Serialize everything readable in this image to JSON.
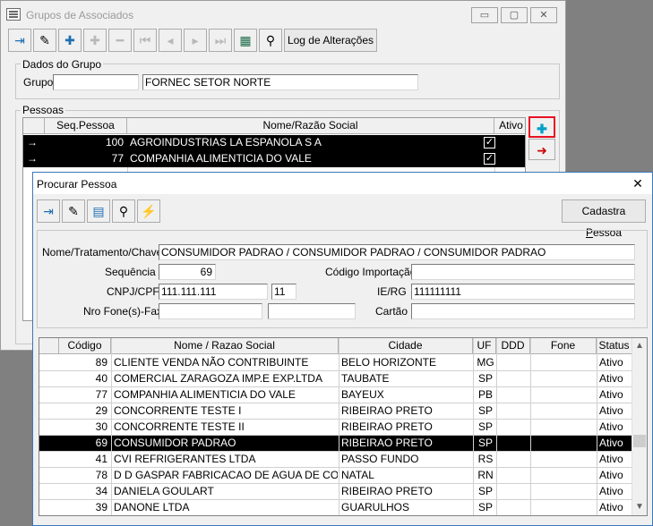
{
  "win1": {
    "title": "Grupos de Associados",
    "caption_minimize": "▭",
    "caption_maximize": "▢",
    "caption_close": "✕",
    "toolbar_log_label": "Log de Alterações",
    "dados_legend": "Dados do Grupo",
    "grupo_label": "Grupo",
    "grupo_code": "",
    "grupo_name": "FORNEC SETOR NORTE",
    "pessoas_legend": "Pessoas",
    "grid_headers": [
      "Seq.Pessoa",
      "Nome/Razão Social",
      "Ativo"
    ],
    "rows": [
      {
        "marker": "→",
        "seq": "100",
        "nome": "AGROINDUSTRIAS LA ESPANOLA S A",
        "ativo": "✓"
      },
      {
        "marker": "→",
        "seq": "77",
        "nome": "COMPANHIA ALIMENTICIA DO VALE",
        "ativo": "✓"
      }
    ],
    "side_add_icon": "add-person-icon",
    "side_remove_icon": "remove-person-icon"
  },
  "win2": {
    "title": "Procurar Pessoa",
    "close_glyph": "✕",
    "cadastra_prefix": "Cadastra ",
    "cadastra_mnemonic": "P",
    "cadastra_suffix": "essoa",
    "nome_label": "Nome/Tratamento/Chave",
    "nome_value": "CONSUMIDOR PADRAO / CONSUMIDOR PADRAO / CONSUMIDOR PADRAO",
    "sequencia_label": "Sequência",
    "sequencia_value": "69",
    "codigo_importacao_label": "Código Importação",
    "codigo_importacao_value": "",
    "cnpj_label": "CNPJ/CPF",
    "cnpj_value": "111.111.111",
    "cnpj_digit": "11",
    "ierg_label": "IE/RG",
    "ierg_value": "111111111",
    "fone_label": "Nro Fone(s)-Fax",
    "fone1_value": "",
    "fone2_value": "",
    "cartao_label": "Cartão",
    "cartao_value": "",
    "grid_headers": [
      "Código",
      "Nome / Razao Social",
      "Cidade",
      "UF",
      "DDD",
      "Fone",
      "Status"
    ],
    "rows": [
      {
        "codigo": "89",
        "nome": "CLIENTE VENDA NÃO CONTRIBUINTE",
        "cidade": "BELO HORIZONTE",
        "uf": "MG",
        "ddd": "",
        "fone": "",
        "status": "Ativo"
      },
      {
        "codigo": "40",
        "nome": "COMERCIAL ZARAGOZA IMP.E EXP.LTDA",
        "cidade": "TAUBATE",
        "uf": "SP",
        "ddd": "",
        "fone": "",
        "status": "Ativo"
      },
      {
        "codigo": "77",
        "nome": "COMPANHIA ALIMENTICIA DO VALE",
        "cidade": "BAYEUX",
        "uf": "PB",
        "ddd": "",
        "fone": "",
        "status": "Ativo"
      },
      {
        "codigo": "29",
        "nome": "CONCORRENTE TESTE I",
        "cidade": "RIBEIRAO PRETO",
        "uf": "SP",
        "ddd": "",
        "fone": "",
        "status": "Ativo"
      },
      {
        "codigo": "30",
        "nome": "CONCORRENTE TESTE II",
        "cidade": "RIBEIRAO PRETO",
        "uf": "SP",
        "ddd": "",
        "fone": "",
        "status": "Ativo"
      },
      {
        "codigo": "69",
        "nome": "CONSUMIDOR PADRAO",
        "cidade": "RIBEIRAO PRETO",
        "uf": "SP",
        "ddd": "",
        "fone": "",
        "status": "Ativo",
        "selected": true
      },
      {
        "codigo": "41",
        "nome": "CVI REFRIGERANTES LTDA",
        "cidade": "PASSO FUNDO",
        "uf": "RS",
        "ddd": "",
        "fone": "",
        "status": "Ativo"
      },
      {
        "codigo": "78",
        "nome": "D D GASPAR FABRICACAO DE AGUA DE COCO E",
        "cidade": "NATAL",
        "uf": "RN",
        "ddd": "",
        "fone": "",
        "status": "Ativo"
      },
      {
        "codigo": "34",
        "nome": "DANIELA GOULART",
        "cidade": "RIBEIRAO PRETO",
        "uf": "SP",
        "ddd": "",
        "fone": "",
        "status": "Ativo"
      },
      {
        "codigo": "39",
        "nome": "DANONE LTDA",
        "cidade": "GUARULHOS",
        "uf": "SP",
        "ddd": "",
        "fone": "",
        "status": "Ativo"
      }
    ],
    "scroll_up": "▲",
    "scroll_down": "▼"
  },
  "colors": {
    "selection": "#000000",
    "highlight_border": "#e81123",
    "accent_blue": "#3c78b4"
  }
}
